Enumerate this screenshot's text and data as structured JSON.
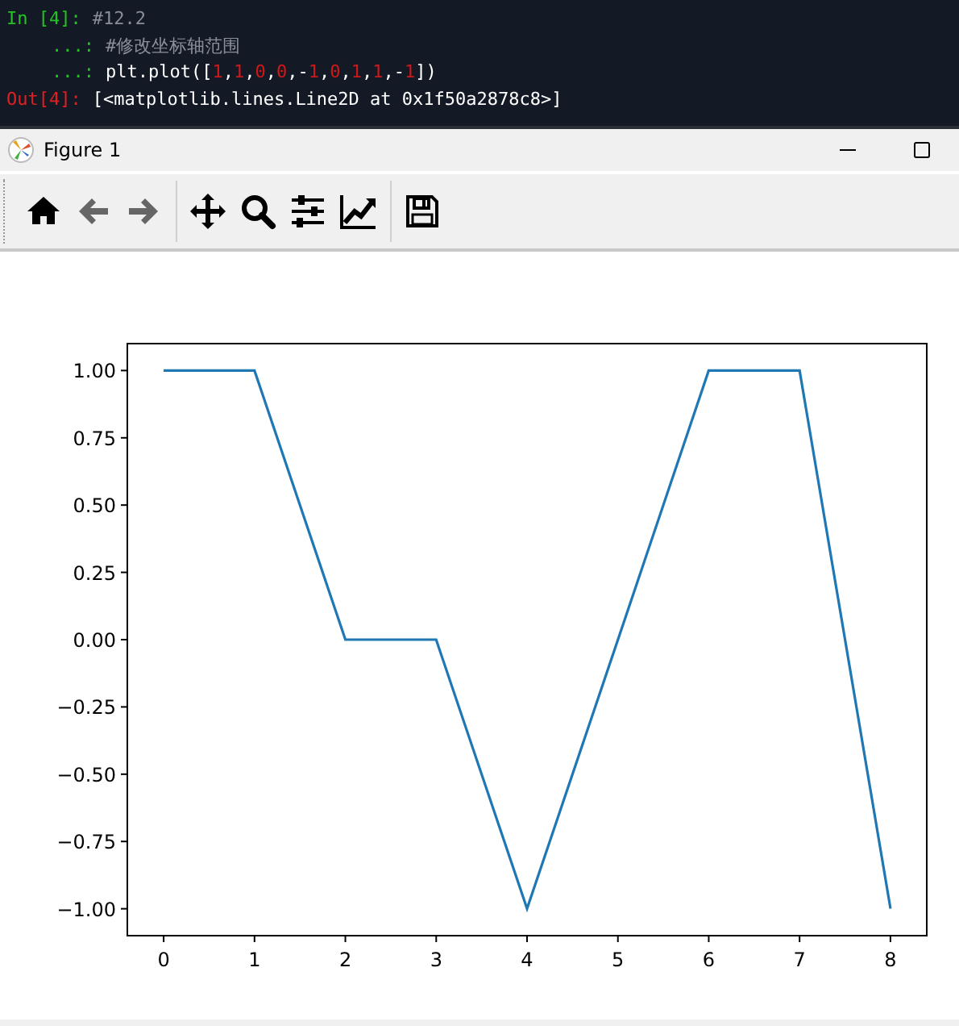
{
  "console": {
    "lines": [
      {
        "kind": "input",
        "prompt": "In [4]:",
        "segments": [
          {
            "kind": "comment",
            "text": "#12.2"
          }
        ]
      },
      {
        "kind": "continuation",
        "prompt": "...:",
        "segments": [
          {
            "kind": "comment",
            "text": "#修改坐标轴范围"
          }
        ]
      },
      {
        "kind": "continuation",
        "prompt": "...:",
        "segments": [
          {
            "kind": "code",
            "text": "plt.plot(["
          },
          {
            "kind": "number",
            "text": "1"
          },
          {
            "kind": "code",
            "text": ","
          },
          {
            "kind": "number",
            "text": "1"
          },
          {
            "kind": "code",
            "text": ","
          },
          {
            "kind": "number",
            "text": "0"
          },
          {
            "kind": "code",
            "text": ","
          },
          {
            "kind": "number",
            "text": "0"
          },
          {
            "kind": "code",
            "text": ",-"
          },
          {
            "kind": "number",
            "text": "1"
          },
          {
            "kind": "code",
            "text": ","
          },
          {
            "kind": "number",
            "text": "0"
          },
          {
            "kind": "code",
            "text": ","
          },
          {
            "kind": "number",
            "text": "1"
          },
          {
            "kind": "code",
            "text": ","
          },
          {
            "kind": "number",
            "text": "1"
          },
          {
            "kind": "code",
            "text": ",-"
          },
          {
            "kind": "number",
            "text": "1"
          },
          {
            "kind": "code",
            "text": "])"
          }
        ]
      },
      {
        "kind": "output",
        "prompt": "Out[4]:",
        "segments": [
          {
            "kind": "code",
            "text": "[<matplotlib.lines.Line2D at 0x1f50a2878c8>]"
          }
        ]
      }
    ]
  },
  "window": {
    "title": "Figure 1"
  },
  "toolbar": {
    "tools": [
      {
        "kind": "home"
      },
      {
        "kind": "back"
      },
      {
        "kind": "forward"
      },
      {
        "kind": "separator"
      },
      {
        "kind": "pan"
      },
      {
        "kind": "zoom"
      },
      {
        "kind": "subplots"
      },
      {
        "kind": "customize"
      },
      {
        "kind": "separator"
      },
      {
        "kind": "save"
      }
    ]
  },
  "figure": {
    "chart_data": {
      "type": "line",
      "x": [
        0,
        1,
        2,
        3,
        4,
        5,
        6,
        7,
        8
      ],
      "series": [
        {
          "color": "#1f77b4",
          "values": [
            1,
            1,
            0,
            0,
            -1,
            0,
            1,
            1,
            -1
          ]
        }
      ],
      "xlim": [
        -0.4,
        8.4
      ],
      "ylim": [
        -1.1,
        1.1
      ],
      "xticks": [
        0,
        1,
        2,
        3,
        4,
        5,
        6,
        7,
        8
      ],
      "yticks": [
        {
          "value": 1,
          "label": "1.00"
        },
        {
          "value": 0.75,
          "label": "0.75"
        },
        {
          "value": 0.5,
          "label": "0.50"
        },
        {
          "value": 0.25,
          "label": "0.25"
        },
        {
          "value": 0,
          "label": "0.00"
        },
        {
          "value": -0.25,
          "label": "−0.25"
        },
        {
          "value": -0.5,
          "label": "−0.50"
        },
        {
          "value": -0.75,
          "label": "−0.75"
        },
        {
          "value": -1,
          "label": "−1.00"
        }
      ]
    }
  }
}
